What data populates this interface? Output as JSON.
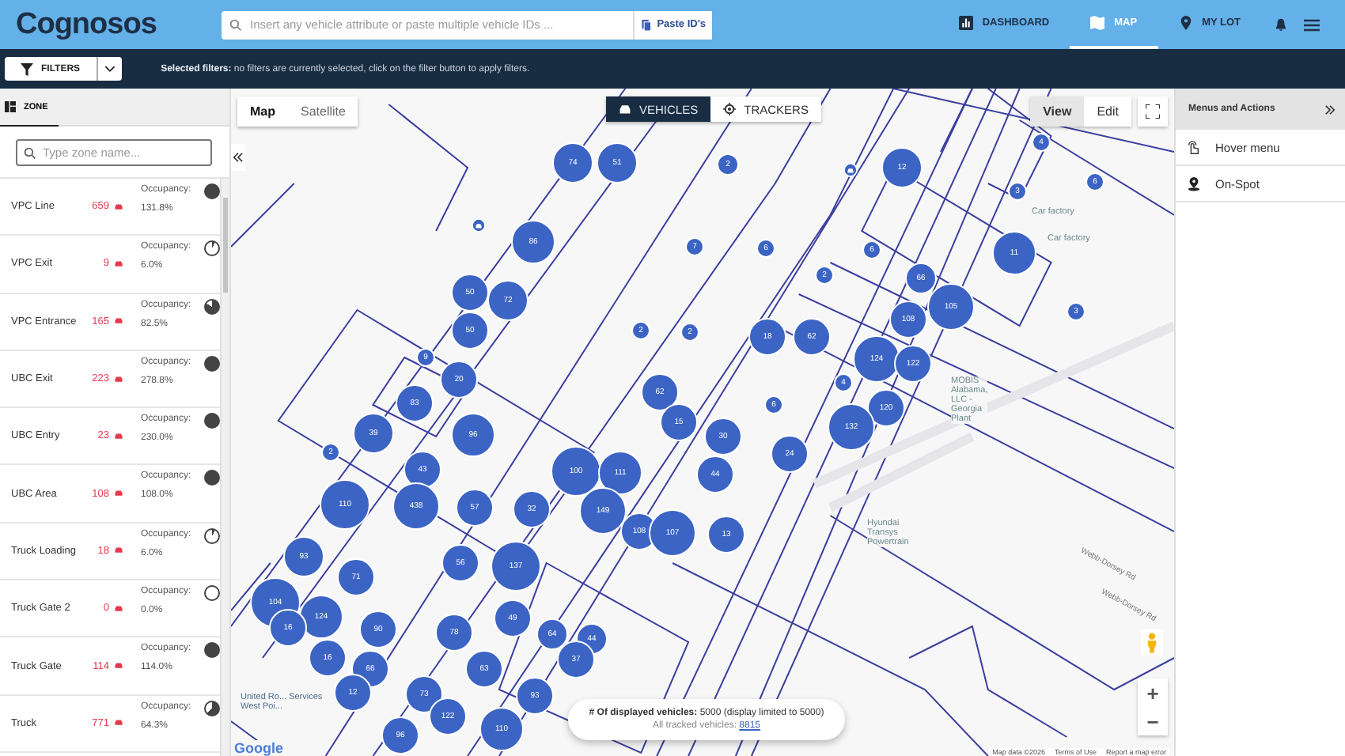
{
  "header": {
    "logo": "Cognosos",
    "search": {
      "placeholder": "Insert any vehicle attribute or paste multiple vehicle IDs ..."
    },
    "paste_button": "Paste ID's",
    "nav": [
      {
        "label": "DASHBOARD",
        "kind": "dashboard",
        "selected": false
      },
      {
        "label": "MAP",
        "kind": "map",
        "selected": true
      },
      {
        "label": "MY LOT",
        "kind": "lot",
        "selected": false
      }
    ]
  },
  "filter_bar": {
    "button": "FILTERS",
    "summary": "**Selected filters:** no filters are currently selected, click on the filter button to apply filters."
  },
  "sidebar": {
    "tab": "ZONE",
    "search": {
      "placeholder": "Type zone name..."
    },
    "zones": [
      {
        "name": "VPC Line",
        "count": "659",
        "label": "Occupancy:",
        "percent": "131.8%",
        "kind": "full"
      },
      {
        "name": "VPC Exit",
        "count": "9",
        "label": "Occupancy:",
        "percent": "6.0%",
        "kind": "sliver"
      },
      {
        "name": "VPC Entrance",
        "count": "165",
        "label": "Occupancy:",
        "percent": "82.5%",
        "kind": "most"
      },
      {
        "name": "UBC Exit",
        "count": "223",
        "label": "Occupancy:",
        "percent": "278.8%",
        "kind": "full"
      },
      {
        "name": "UBC Entry",
        "count": "23",
        "label": "Occupancy:",
        "percent": "230.0%",
        "kind": "full"
      },
      {
        "name": "UBC Area",
        "count": "108",
        "label": "Occupancy:",
        "percent": "108.0%",
        "kind": "full"
      },
      {
        "name": "Truck Loading",
        "count": "18",
        "label": "Occupancy:",
        "percent": "6.0%",
        "kind": "sliver"
      },
      {
        "name": "Truck Gate 2",
        "count": "0",
        "label": "Occupancy:",
        "percent": "0.0%",
        "kind": "empty"
      },
      {
        "name": "Truck Gate",
        "count": "114",
        "label": "Occupancy:",
        "percent": "114.0%",
        "kind": "full"
      },
      {
        "name": "Truck",
        "count": "771",
        "label": "Occupancy:",
        "percent": "64.3%",
        "kind": "partial"
      }
    ]
  },
  "map": {
    "map_types": [
      {
        "label": "Map",
        "selected": true
      },
      {
        "label": "Satellite",
        "selected": false
      }
    ],
    "modes": [
      {
        "label": "VEHICLES",
        "kind": "vehicles",
        "selected": true
      },
      {
        "label": "TRACKERS",
        "kind": "trackers",
        "selected": false
      }
    ],
    "edit_modes": [
      {
        "label": "View",
        "selected": true
      },
      {
        "label": "Edit",
        "selected": false
      }
    ],
    "clusters": [
      {
        "label": "4"
      },
      {
        "label": "74"
      },
      {
        "label": "51"
      },
      {
        "label": "2"
      },
      {
        "label": "12"
      },
      {
        "label": "6"
      },
      {
        "label": "3"
      },
      {
        "label": "86"
      },
      {
        "label": "7"
      },
      {
        "label": "6"
      },
      {
        "label": "6"
      },
      {
        "label": "11"
      },
      {
        "label": "2"
      },
      {
        "label": "66"
      },
      {
        "label": "50"
      },
      {
        "label": "72"
      },
      {
        "label": "105"
      },
      {
        "label": "3"
      },
      {
        "label": "108"
      },
      {
        "label": "50"
      },
      {
        "label": "2"
      },
      {
        "label": "2"
      },
      {
        "label": "18"
      },
      {
        "label": "62"
      },
      {
        "label": "9"
      },
      {
        "label": "124"
      },
      {
        "label": "122"
      },
      {
        "label": "20"
      },
      {
        "label": "4"
      },
      {
        "label": "62"
      },
      {
        "label": "83"
      },
      {
        "label": "6"
      },
      {
        "label": "120"
      },
      {
        "label": "15"
      },
      {
        "label": "132"
      },
      {
        "label": "39"
      },
      {
        "label": "96"
      },
      {
        "label": "30"
      },
      {
        "label": "2"
      },
      {
        "label": "24"
      },
      {
        "label": "43"
      },
      {
        "label": "100"
      },
      {
        "label": "111"
      },
      {
        "label": "44"
      },
      {
        "label": "110"
      },
      {
        "label": "438"
      },
      {
        "label": "57"
      },
      {
        "label": "32"
      },
      {
        "label": "149"
      },
      {
        "label": "108"
      },
      {
        "label": "107"
      },
      {
        "label": "13"
      },
      {
        "label": "93"
      },
      {
        "label": "56"
      },
      {
        "label": "137"
      },
      {
        "label": "71"
      },
      {
        "label": "104"
      },
      {
        "label": "124"
      },
      {
        "label": "49"
      },
      {
        "label": "16"
      },
      {
        "label": "90"
      },
      {
        "label": "78"
      },
      {
        "label": "64"
      },
      {
        "label": "44"
      },
      {
        "label": "16"
      },
      {
        "label": "37"
      },
      {
        "label": "66"
      },
      {
        "label": "63"
      },
      {
        "label": "12"
      },
      {
        "label": "73"
      },
      {
        "label": "93"
      },
      {
        "label": "122"
      },
      {
        "label": "110"
      },
      {
        "label": "96"
      }
    ],
    "places": [
      {
        "label": "Car factory",
        "kind": "poi"
      },
      {
        "label": "Car factory",
        "kind": "poi"
      },
      {
        "label": "MOBIS Alabama, LLC - Georgia Plant",
        "kind": "poi"
      },
      {
        "label": "Hyundai Transys Powertrain",
        "kind": "poi"
      },
      {
        "label": "United Ro... Services West Poi...",
        "kind": "plain"
      }
    ],
    "roads": [
      "Webb-Dorsey Rd",
      "Webb-Dorsey Rd"
    ],
    "summary": {
      "displayed": "**# Of displayed vehicles:** 5000 (display limited to 5000)",
      "tracked_label": "All tracked vehicles:",
      "tracked_link": "8815"
    },
    "brand": "Google",
    "attribution": [
      "Map data ©2026",
      "Terms of Use",
      "Report a map error"
    ],
    "zoom": [
      "+",
      "−"
    ]
  },
  "right_panel": {
    "title": "Menus and Actions",
    "items": [
      {
        "label": "Hover menu",
        "kind": "hover"
      },
      {
        "label": "On-Spot",
        "kind": "spot"
      }
    ]
  }
}
